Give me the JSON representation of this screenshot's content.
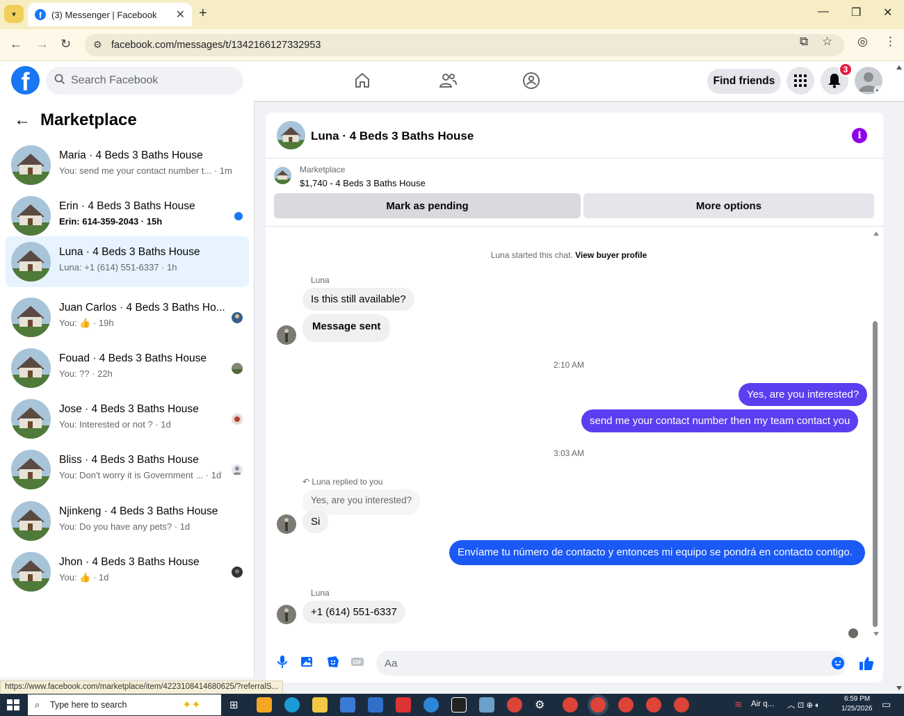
{
  "browser": {
    "tab_title": "(3) Messenger | Facebook",
    "url": "facebook.com/messages/t/1342166127332953",
    "status_url": "https://www.facebook.com/marketplace/item/4223108414680625/?referralS..."
  },
  "fb": {
    "search_placeholder": "Search Facebook",
    "find_friends": "Find friends",
    "notification_count": "3",
    "brand_color": "#1877f2"
  },
  "sidebar": {
    "title": "Marketplace",
    "conversations": [
      {
        "name": "Maria · 4 Beds 3 Baths House",
        "snippet": "You: send me your contact number t... · 1m",
        "unread": false,
        "active": false
      },
      {
        "name": "Erin · 4 Beds 3 Baths House",
        "snippet": "Erin: 614-359-2043 · 15h",
        "unread": true,
        "active": false
      },
      {
        "name": "Luna · 4 Beds 3 Baths House",
        "snippet": "Luna: +1 (614) 551-6337 · 1h",
        "unread": false,
        "active": true
      },
      {
        "name": "Juan Carlos · 4 Beds 3 Baths Ho...",
        "snippet": "You: 👍 · 19h",
        "unread": false,
        "active": false
      },
      {
        "name": "Fouad · 4 Beds 3 Baths House",
        "snippet": "You: ?? · 22h",
        "unread": false,
        "active": false
      },
      {
        "name": "Jose · 4 Beds 3 Baths House",
        "snippet": "You: Interested or not ? · 1d",
        "unread": false,
        "active": false
      },
      {
        "name": "Bliss · 4 Beds 3 Baths House",
        "snippet": "You: Don't worry it is Government ... · 1d",
        "unread": false,
        "active": false
      },
      {
        "name": "Njinkeng · 4 Beds 3 Baths House",
        "snippet": "You: Do you have any pets? · 1d",
        "unread": false,
        "active": false
      },
      {
        "name": "Jhon · 4 Beds 3 Baths House",
        "snippet": "You: 👍 · 1d",
        "unread": false,
        "active": false
      }
    ]
  },
  "chat": {
    "title": "Luna · 4 Beds 3 Baths House",
    "listing_label": "Marketplace",
    "listing_price": "$1,740 - 4 Beds 3 Baths House",
    "mark_pending": "Mark as pending",
    "more_options": "More options",
    "started_text": "Luna started this chat.",
    "view_profile": "View buyer profile",
    "sender_name": "Luna",
    "msg1": "Is this still available?",
    "msg2": "Message sent",
    "time1": "2:10 AM",
    "out1": "Yes, are you interested?",
    "out2": "send me your contact number then my team contact you",
    "time2": "3:03 AM",
    "reply_note": "Luna replied to you",
    "quoted": "Yes, are you interested?",
    "msg3": "Si",
    "out3": "Envíame tu número de contacto y entonces mi equipo se pondrá en contacto contigo.",
    "msg4": "+1 (614) 551-6337",
    "composer_placeholder": "Aa"
  },
  "taskbar": {
    "search_placeholder": "Type here to search",
    "weather": "Air q...",
    "time": "6:59 PM",
    "date": "1/25/2026"
  }
}
